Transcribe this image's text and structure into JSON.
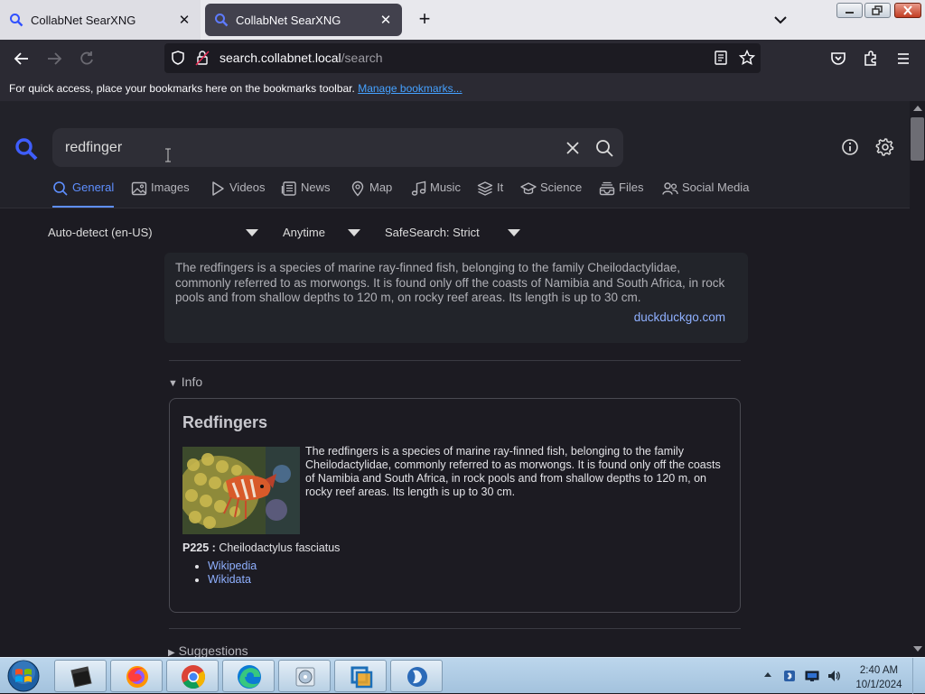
{
  "browser": {
    "tabs": [
      {
        "title": "CollabNet SearXNG",
        "active": false
      },
      {
        "title": "CollabNet SearXNG",
        "active": true
      }
    ],
    "url_host": "search.collabnet.local",
    "url_path": "/search",
    "bookmarks_hint": "For quick access, place your bookmarks here on the bookmarks toolbar.",
    "bookmarks_link": "Manage bookmarks..."
  },
  "search": {
    "query": "redfinger"
  },
  "categories": [
    {
      "label": "General",
      "icon": "search-icon",
      "active": true
    },
    {
      "label": "Images",
      "icon": "image-icon"
    },
    {
      "label": "Videos",
      "icon": "play-icon"
    },
    {
      "label": "News",
      "icon": "newspaper-icon"
    },
    {
      "label": "Map",
      "icon": "map-pin-icon"
    },
    {
      "label": "Music",
      "icon": "music-note-icon"
    },
    {
      "label": "It",
      "icon": "layers-icon"
    },
    {
      "label": "Science",
      "icon": "school-icon"
    },
    {
      "label": "Files",
      "icon": "file-tray-icon"
    },
    {
      "label": "Social Media",
      "icon": "people-icon"
    }
  ],
  "filters": {
    "language": "Auto-detect (en-US)",
    "time": "Anytime",
    "safesearch": "SafeSearch: Strict"
  },
  "answer": {
    "text": "The redfingers is a species of marine ray-finned fish, belonging to the family Cheilodactylidae, commonly referred to as morwongs. It is found only off the coasts of Namibia and South Africa, in rock pools and from shallow depths to 120 m, on rocky reef areas. Its length is up to 30 cm.",
    "source": "duckduckgo.com"
  },
  "info_summary": "Info",
  "infobox": {
    "title": "Redfingers",
    "text": "The redfingers is a species of marine ray-finned fish, belonging to the family Cheilodactylidae, commonly referred to as morwongs. It is found only off the coasts of Namibia and South Africa, in rock pools and from shallow depths to 120 m, on rocky reef areas. Its length is up to 30 cm.",
    "attr_key": "P225 :",
    "attr_value": "Cheilodactylus fasciatus",
    "links": [
      "Wikipedia",
      "Wikidata"
    ]
  },
  "suggestions_summary": "Suggestions",
  "taskbar": {
    "time": "2:40 AM",
    "date": "10/1/2024"
  },
  "colors": {
    "accent": "#5e8fff",
    "link": "#8fb0ff",
    "page_bg": "#1c1b22"
  }
}
